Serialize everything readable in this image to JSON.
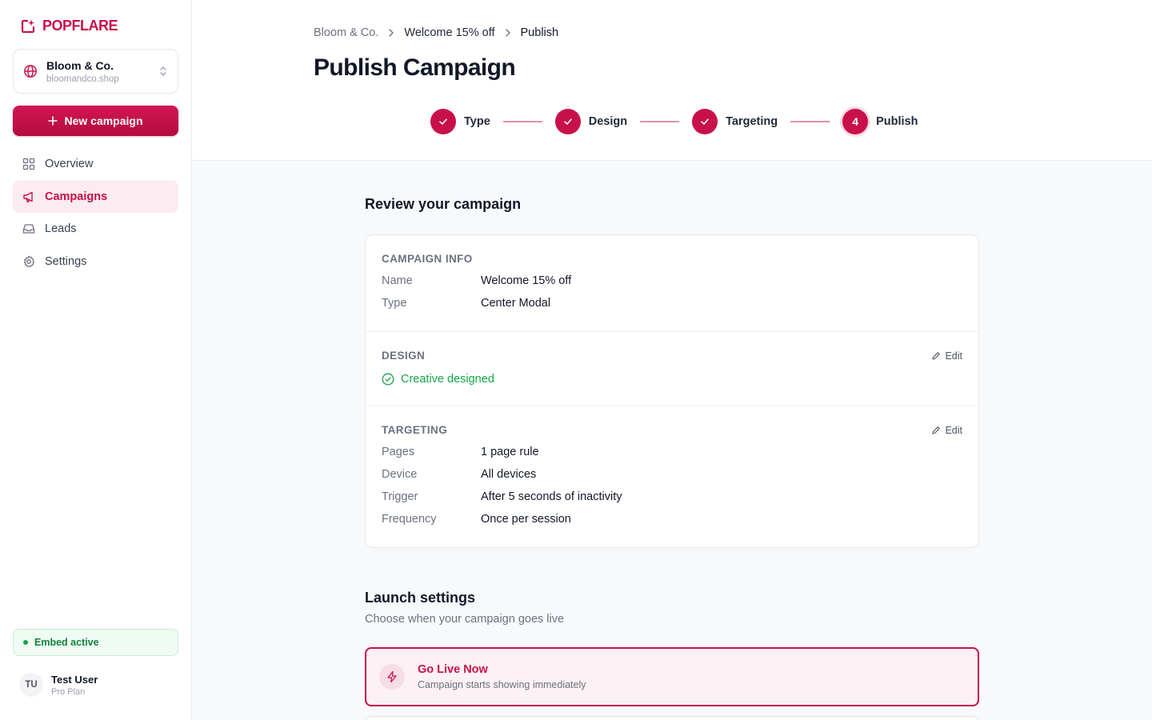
{
  "brand": {
    "name": "POPFLARE",
    "accent": "#c8104a"
  },
  "store": {
    "name": "Bloom & Co.",
    "domain": "bloomandco.shop"
  },
  "new_campaign_label": "New campaign",
  "nav": [
    {
      "label": "Overview",
      "icon": "grid-icon",
      "active": false
    },
    {
      "label": "Campaigns",
      "icon": "megaphone-icon",
      "active": true
    },
    {
      "label": "Leads",
      "icon": "inbox-icon",
      "active": false
    },
    {
      "label": "Settings",
      "icon": "gear-icon",
      "active": false
    }
  ],
  "embed_status": "Embed active",
  "user": {
    "initials": "TU",
    "name": "Test User",
    "plan": "Pro Plan"
  },
  "breadcrumb": [
    "Bloom & Co.",
    "Welcome 15% off",
    "Publish"
  ],
  "page_title": "Publish Campaign",
  "steps": [
    {
      "label": "Type",
      "state": "complete"
    },
    {
      "label": "Design",
      "state": "complete"
    },
    {
      "label": "Targeting",
      "state": "complete"
    },
    {
      "label": "Publish",
      "number": "4",
      "state": "current"
    }
  ],
  "review": {
    "title": "Review your campaign",
    "campaign_info": {
      "heading": "Campaign info",
      "rows": [
        {
          "key": "Name",
          "value": "Welcome 15% off"
        },
        {
          "key": "Type",
          "value": "Center Modal"
        }
      ]
    },
    "design": {
      "heading": "Design",
      "edit_label": "Edit",
      "status": "Creative designed"
    },
    "targeting": {
      "heading": "Targeting",
      "edit_label": "Edit",
      "rows": [
        {
          "key": "Pages",
          "value": "1 page rule"
        },
        {
          "key": "Device",
          "value": "All devices"
        },
        {
          "key": "Trigger",
          "value": "After 5 seconds of inactivity"
        },
        {
          "key": "Frequency",
          "value": "Once per session"
        }
      ]
    }
  },
  "launch": {
    "title": "Launch settings",
    "subtitle": "Choose when your campaign goes live",
    "options": [
      {
        "title": "Go Live Now",
        "description": "Campaign starts showing immediately",
        "selected": true,
        "icon": "lightning-icon"
      }
    ]
  }
}
